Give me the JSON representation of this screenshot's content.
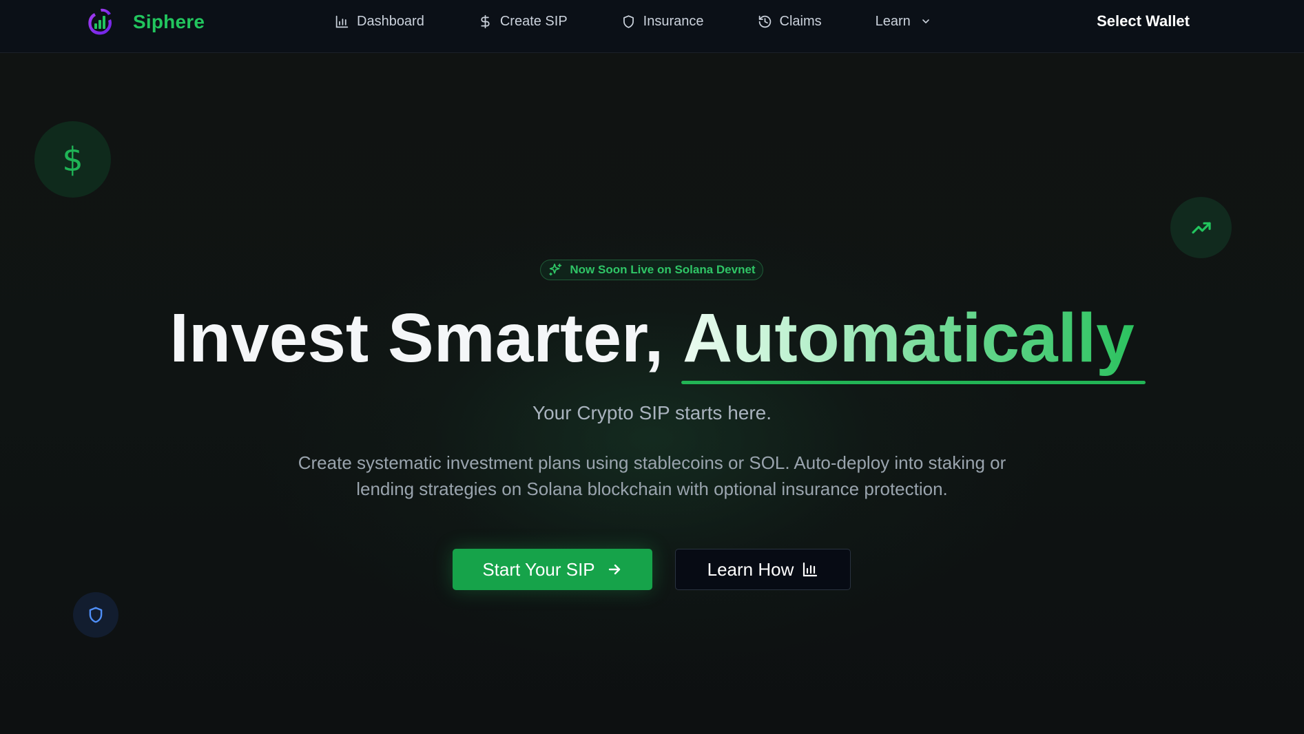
{
  "colors": {
    "accent": "#22c55e",
    "primary_button": "#16a34a",
    "background": "#0e1012",
    "navbar": "#0b1017",
    "logo_purple": "#8b2cf5",
    "shield_blue": "#4f8ff7"
  },
  "header": {
    "brand": {
      "name": "Siphere",
      "logo_icon": "bar-chart-loop-logo"
    },
    "nav": {
      "dashboard": {
        "label": "Dashboard",
        "icon": "bar-chart-icon"
      },
      "create_sip": {
        "label": "Create SIP",
        "icon": "dollar-icon"
      },
      "insurance": {
        "label": "Insurance",
        "icon": "shield-icon"
      },
      "claims": {
        "label": "Claims",
        "icon": "history-icon"
      },
      "learn": {
        "label": "Learn",
        "icon": "chevron-down-icon"
      }
    },
    "wallet_button": "Select Wallet"
  },
  "decorations": {
    "dollar_icon": {
      "glyph": "$",
      "icon": "dollar-icon"
    },
    "trend_icon": "trending-up-icon",
    "shield_icon": "shield-icon"
  },
  "hero": {
    "badge": {
      "icon": "sparkles-icon",
      "text": "Now Soon Live on Solana Devnet"
    },
    "title": {
      "plain": "Invest Smarter, ",
      "accent": "Automatically"
    },
    "subtitle": "Your Crypto SIP starts here.",
    "description": "Create systematic investment plans using stablecoins or SOL. Auto-deploy into staking or lending strategies on Solana blockchain with optional insurance protection.",
    "primary_cta": {
      "label": "Start Your SIP",
      "icon": "arrow-right-icon"
    },
    "secondary_cta": {
      "label": "Learn How",
      "icon": "bar-chart-icon"
    }
  }
}
